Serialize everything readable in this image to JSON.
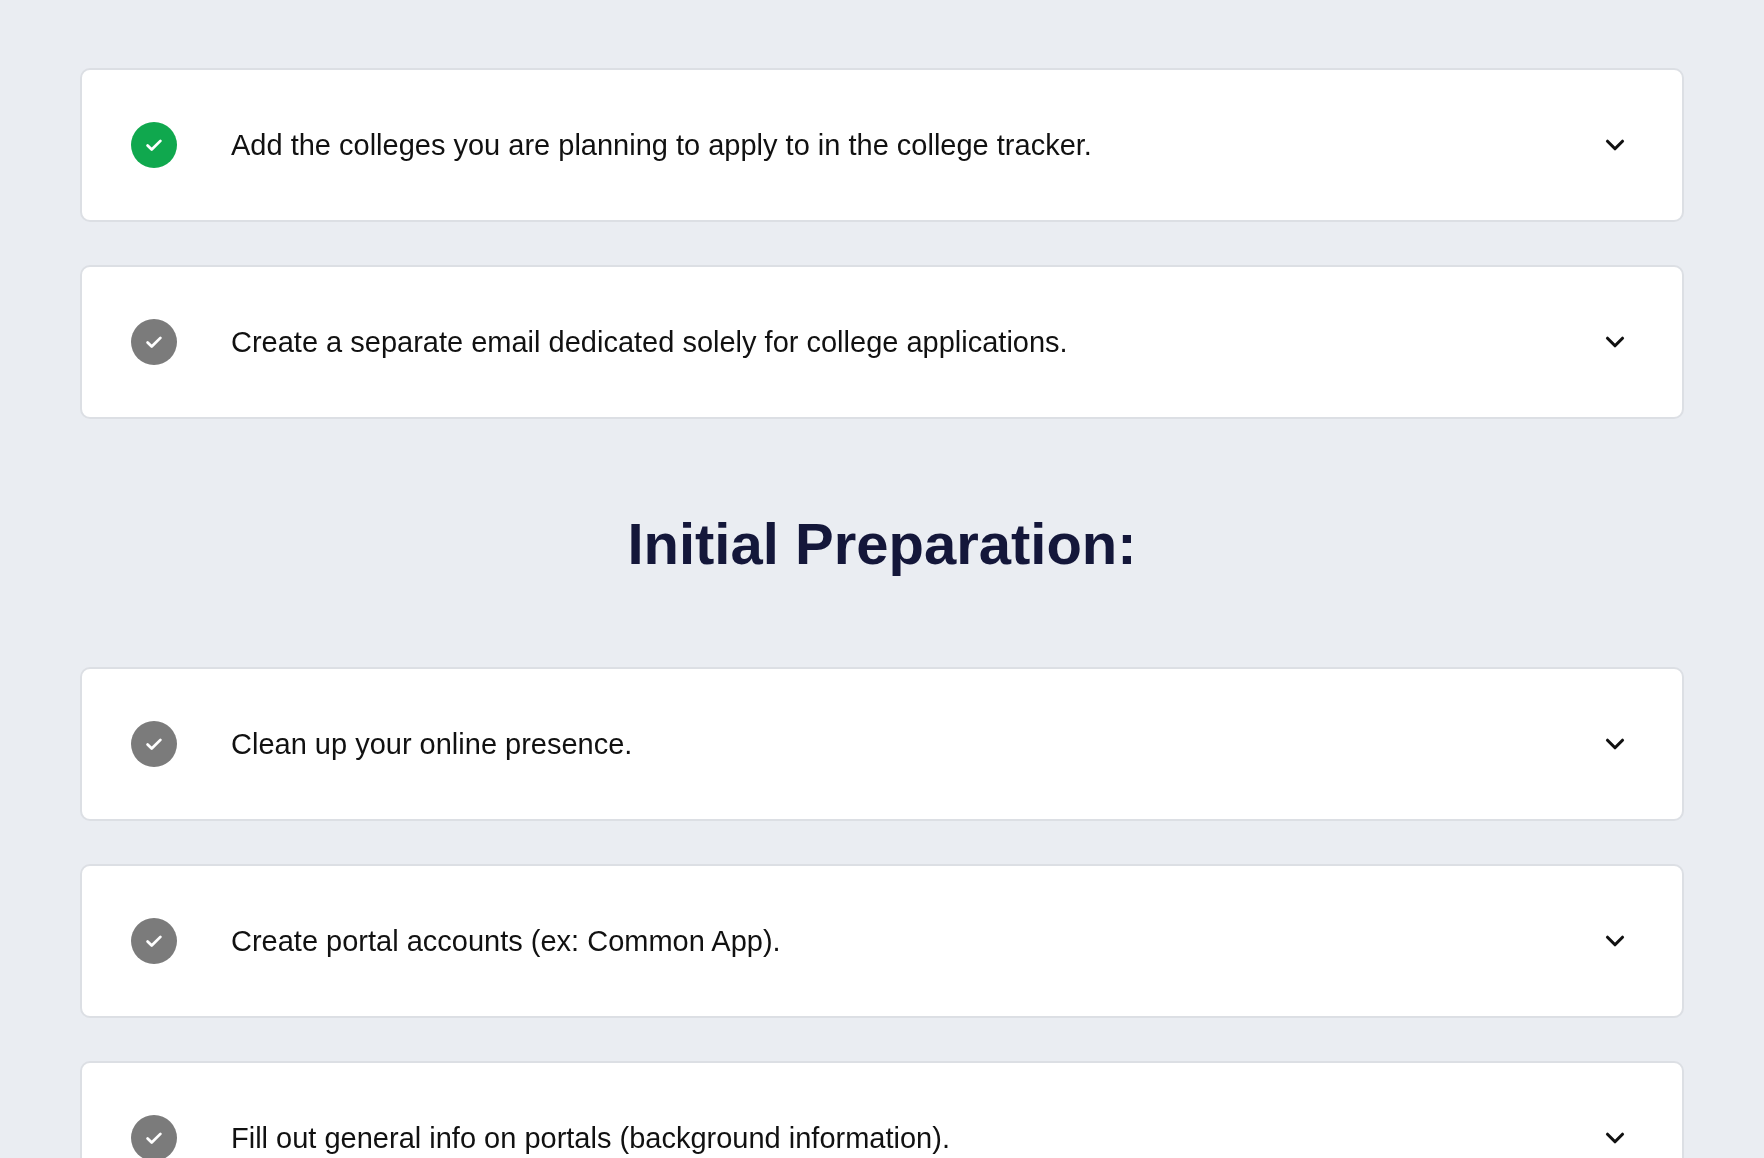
{
  "blocks": [
    {
      "kind": "task",
      "text": "Add the colleges you are planning to apply to in the college tracker.",
      "completed": true
    },
    {
      "kind": "task",
      "text": "Create a separate email dedicated solely for college applications.",
      "completed": false
    },
    {
      "kind": "heading",
      "text": "Initial Preparation:"
    },
    {
      "kind": "task",
      "text": "Clean up your online presence.",
      "completed": false
    },
    {
      "kind": "task",
      "text": "Create portal accounts (ex: Common App).",
      "completed": false
    },
    {
      "kind": "task",
      "text": "Fill out general info on portals (background information).",
      "completed": false
    }
  ]
}
